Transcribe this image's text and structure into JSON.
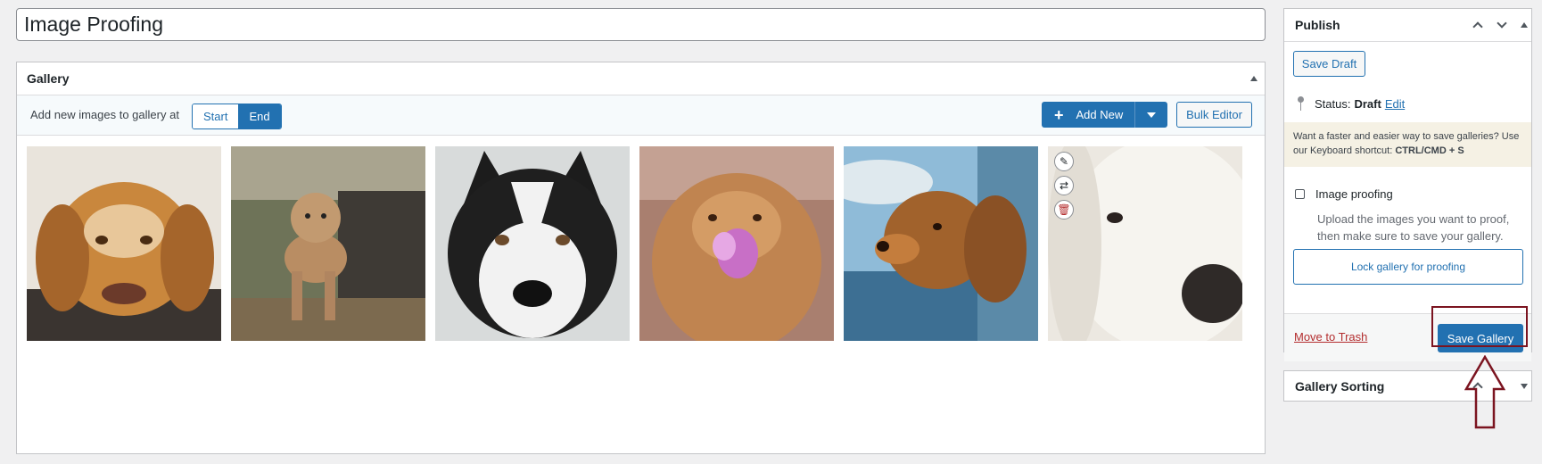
{
  "post": {
    "title": "Image Proofing"
  },
  "gallery": {
    "heading": "Gallery",
    "add_at_label": "Add new images to gallery at",
    "position_options": [
      "Start",
      "End"
    ],
    "position_selected": "End",
    "add_new_label": "Add New",
    "bulk_editor_label": "Bulk Editor",
    "images": [
      {
        "name": "golden-dog-lying"
      },
      {
        "name": "poodle-standing"
      },
      {
        "name": "husky-portrait"
      },
      {
        "name": "golden-retriever-flower"
      },
      {
        "name": "spaniel-car-window"
      },
      {
        "name": "white-retriever-closeup"
      }
    ],
    "thumb_tools": [
      "pencil-icon",
      "shuffle-icon",
      "trash-icon"
    ]
  },
  "publish": {
    "heading": "Publish",
    "save_draft_label": "Save Draft",
    "status_label": "Status:",
    "status_value": "Draft",
    "status_edit": "Edit",
    "tip_text": "Want a faster and easier way to save galleries? Use our Keyboard shortcut:",
    "tip_shortcut": "CTRL/CMD + S",
    "proofing_title": "Image proofing",
    "proofing_desc": "Upload the images you want to proof, then make sure to save your gallery.",
    "lock_label": "Lock gallery for proofing",
    "trash_label": "Move to Trash",
    "save_gallery_label": "Save Gallery"
  },
  "sorting": {
    "heading": "Gallery Sorting"
  },
  "colors": {
    "accent": "#2271b1",
    "danger": "#b32d2e",
    "highlight": "#7b1420"
  }
}
